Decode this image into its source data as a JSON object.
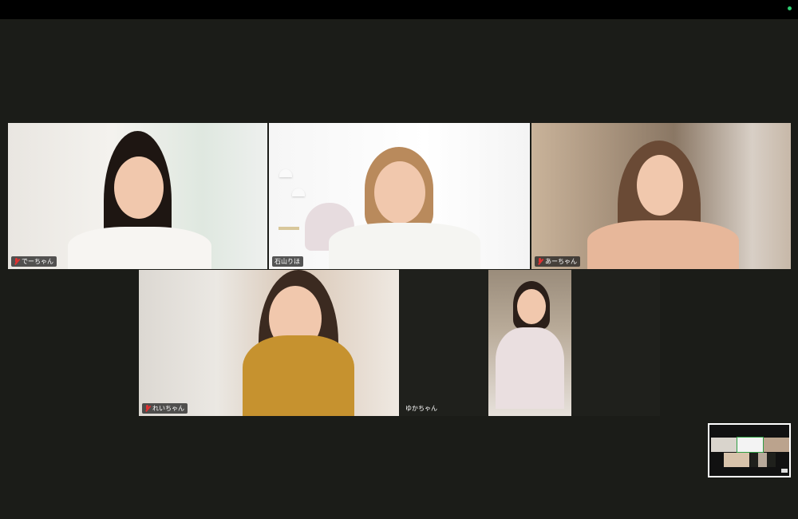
{
  "participants": [
    {
      "name": "でーちゃん",
      "muted": true
    },
    {
      "name": "石山りほ",
      "muted": false,
      "active_speaker": true
    },
    {
      "name": "あーちゃん",
      "muted": true
    },
    {
      "name": "れいちゃん",
      "muted": true
    },
    {
      "name": "ゆかちゃん",
      "muted": false
    }
  ],
  "colors": {
    "active_border": "#2f9e44",
    "mute_icon": "#e03131",
    "status_dot": "#2ecc71"
  }
}
